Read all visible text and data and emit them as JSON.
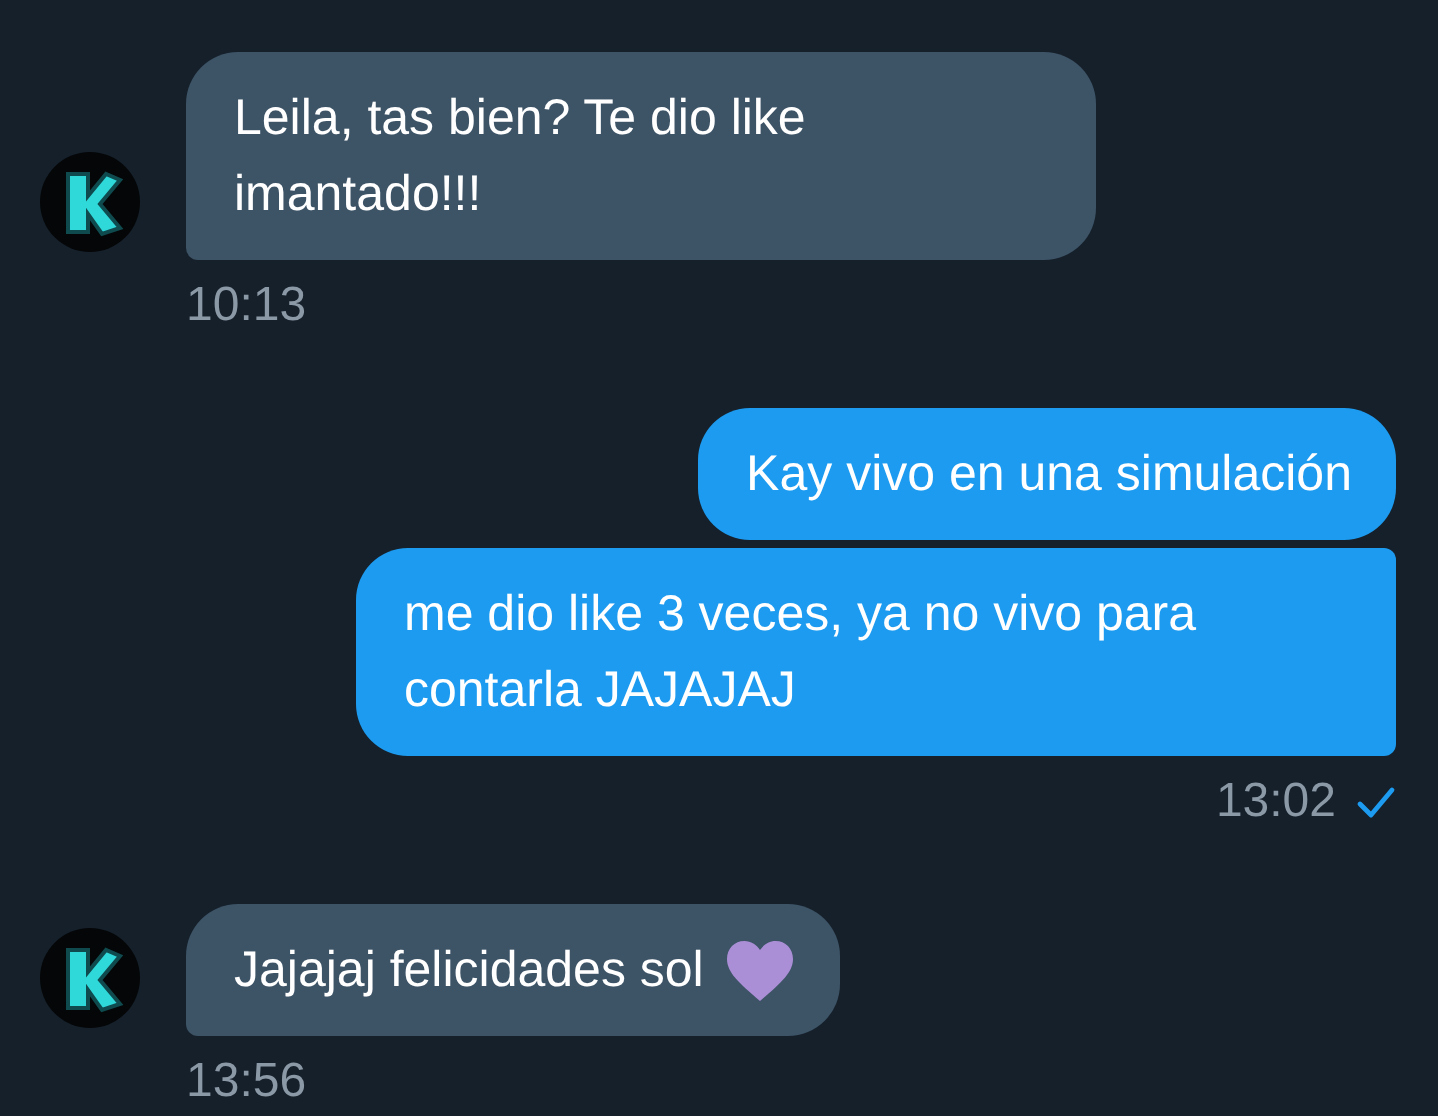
{
  "messages": [
    {
      "kind": "incoming",
      "bubbles": [
        {
          "text": "Leila, tas bien? Te dio like imantado!!!",
          "heart": false
        }
      ],
      "time": "10:13"
    },
    {
      "kind": "outgoing",
      "bubbles": [
        {
          "text": "Kay vivo en una simulación",
          "heart": false
        },
        {
          "text": "me dio like 3 veces, ya no vivo para contarla JAJAJAJ",
          "heart": false
        }
      ],
      "time": "13:02",
      "read": true
    },
    {
      "kind": "incoming",
      "bubbles": [
        {
          "text": "Jajajaj felicidades sol",
          "heart": true
        }
      ],
      "time": "13:56"
    }
  ]
}
